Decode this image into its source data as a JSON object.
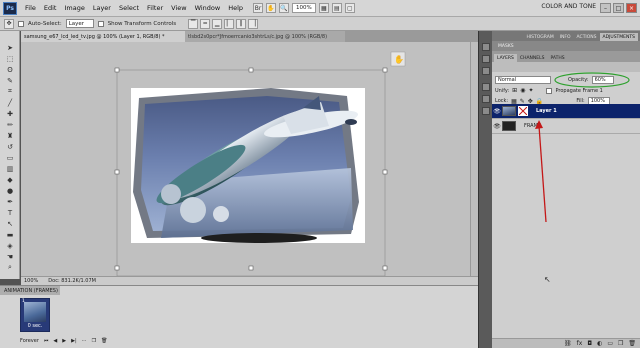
{
  "app": {
    "logo": "Ps",
    "workspace_label": "COLOR AND TONE"
  },
  "menu": [
    "File",
    "Edit",
    "Image",
    "Layer",
    "Select",
    "Filter",
    "View",
    "Window",
    "Help"
  ],
  "menubar_zoom": "100%",
  "options": {
    "auto_select_label": "Auto-Select:",
    "auto_select_value": "Layer",
    "transform_label": "Show Transform Controls"
  },
  "document_tabs": [
    {
      "label": "samsung_e67_lcd_led_tv.jpg @ 100% (Layer 1, RGB/8) *",
      "active": true
    },
    {
      "label": "tlsbd2s0pcr*Jfmoerrcanio3shtrLs/c.jpg @ 100% (RGB/8)",
      "active": false
    }
  ],
  "canvas": {
    "move_icon": "move-icon"
  },
  "status": {
    "zoom": "100%",
    "doc": "Doc: 831.2K/1.07M"
  },
  "animation": {
    "title": "ANIMATION (FRAMES)",
    "frame_number": "1",
    "frame_time": "0 sec.",
    "loop": "Forever"
  },
  "panels": {
    "top_tabs": [
      "HISTOGRAM",
      "INFO",
      "ACTIONS",
      "ADJUSTMENTS"
    ],
    "masks_label": "MASKS",
    "layer_tabs": [
      "LAYERS",
      "CHANNELS",
      "PATHS"
    ],
    "blend_mode": "Normal",
    "opacity_label": "Opacity:",
    "opacity_value": "60%",
    "unify_label": "Unify:",
    "propagate_label": "Propagate Frame 1",
    "lock_label": "Lock:",
    "fill_label": "Fill:",
    "fill_value": "100%",
    "layers": [
      {
        "name": "Layer 1",
        "selected": true
      },
      {
        "name": "FRAME",
        "selected": false
      }
    ]
  },
  "colors": {
    "selected_layer": "#0c236b",
    "highlight_oval": "#2ea12e",
    "arrow": "#c41818"
  }
}
